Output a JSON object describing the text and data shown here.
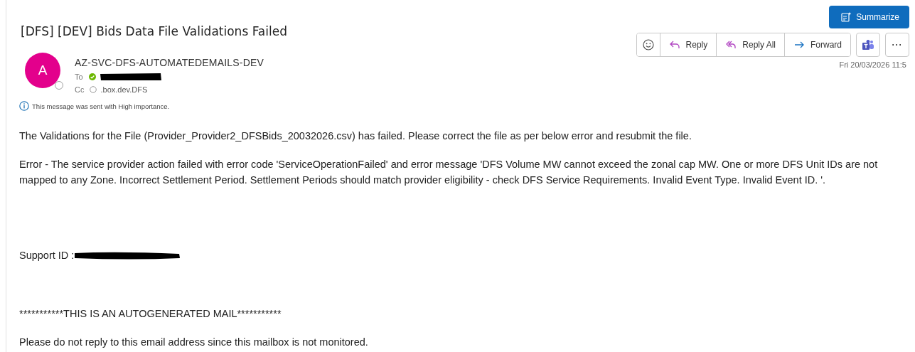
{
  "subject": "[DFS] [DEV] Bids Data File Validations Failed",
  "sender": {
    "initial": "A",
    "name": "AZ-SVC-DFS-AUTOMATEDEMAILS-DEV",
    "online": false
  },
  "recipients": [
    {
      "label": "To",
      "online": true,
      "name_redacted": true
    },
    {
      "label": "Cc",
      "online": false,
      "name": ".box.dev.DFS"
    }
  ],
  "importance_note": "This message was sent with High importance.",
  "summarize_button": "Summarize",
  "actions": [
    {
      "kind": "emoji"
    },
    {
      "kind": "reply",
      "label": "Reply"
    },
    {
      "kind": "reply-all",
      "label": "Reply All"
    },
    {
      "kind": "forward",
      "label": "Forward"
    }
  ],
  "extra_buttons": [
    {
      "kind": "teams"
    },
    {
      "kind": "more",
      "label": "···"
    }
  ],
  "date": "Fri 20/03/2026 11:5",
  "body": [
    {
      "kind": "text",
      "text": "The Validations for the File (Provider_Provider2_DFSBids_20032026.csv) has failed. Please correct the file as per below error and resubmit the file."
    },
    {
      "kind": "text",
      "text": "Error - The service provider action failed with error code 'ServiceOperationFailed' and error message 'DFS Volume MW cannot exceed the zonal cap MW. One or more DFS Unit IDs are not mapped to any Zone. Incorrect Settlement Period. Settlement Periods should match provider eligibility - check DFS Service Requirements. Invalid Event Type. Invalid Event ID. '."
    },
    {
      "kind": "gap"
    },
    {
      "kind": "redacted",
      "text": "Support ID :"
    },
    {
      "kind": "gap"
    },
    {
      "kind": "text",
      "text": "***********THIS IS AN AUTOGENERATED MAIL***********"
    },
    {
      "kind": "text",
      "text": "Please do not reply to this email address since this mailbox is not monitored."
    }
  ]
}
